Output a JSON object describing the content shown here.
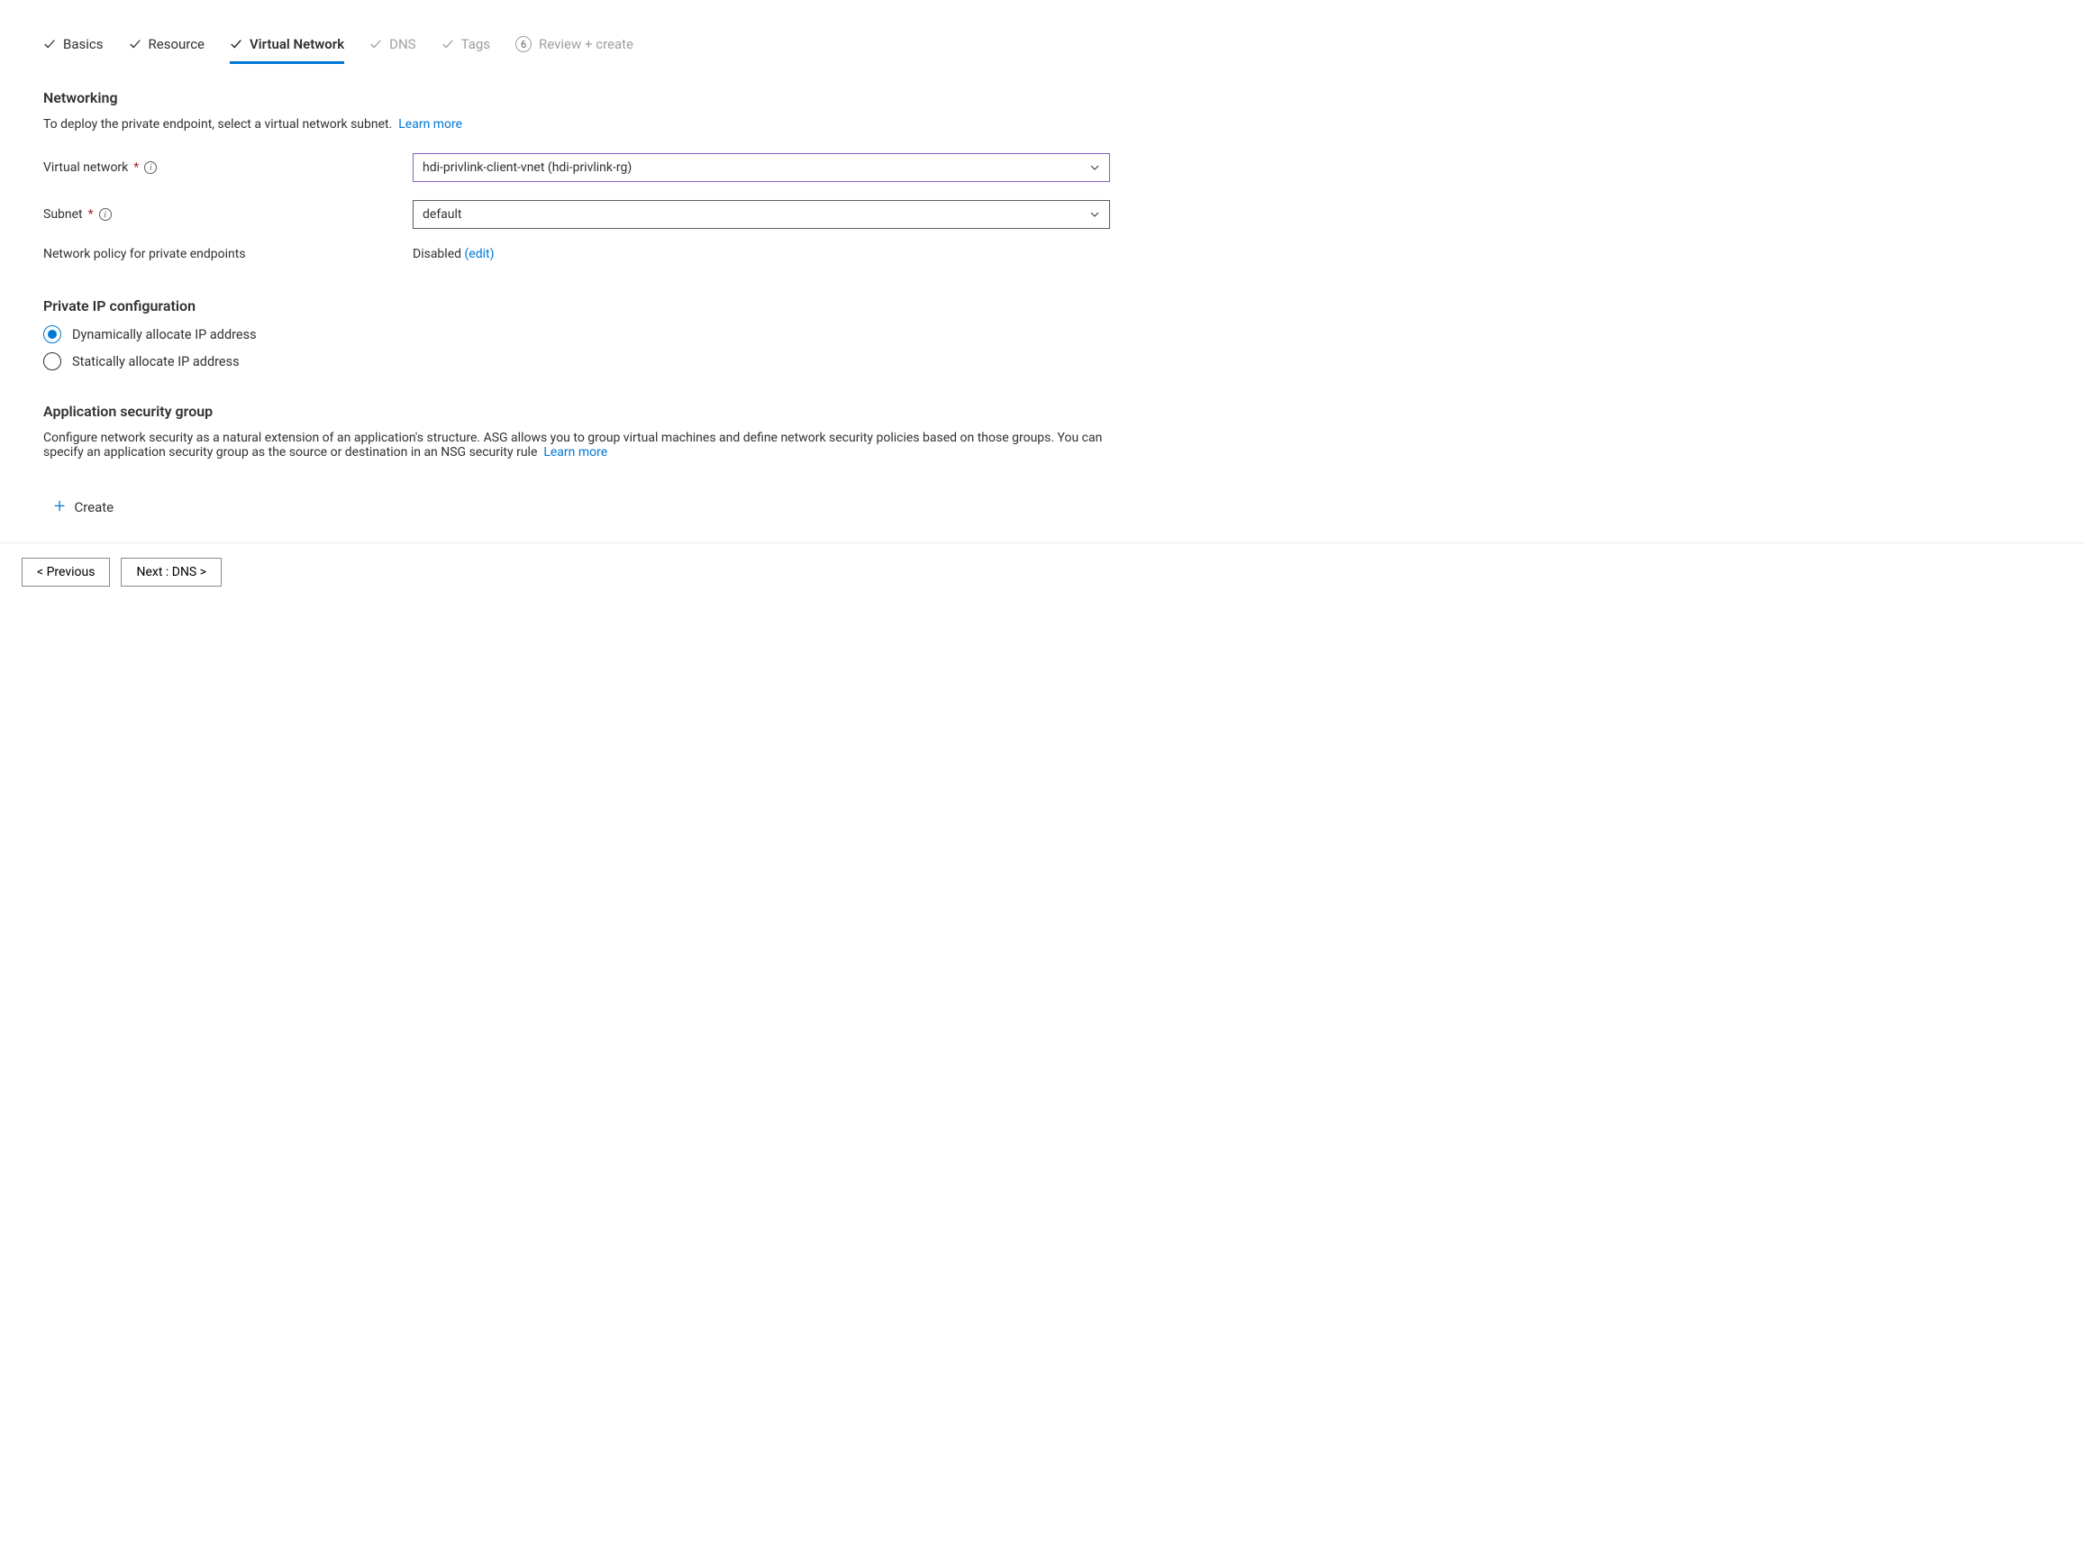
{
  "tabs": {
    "basics": "Basics",
    "resource": "Resource",
    "virtual_network": "Virtual Network",
    "dns": "DNS",
    "tags": "Tags",
    "review_step": "6",
    "review": "Review + create"
  },
  "networking": {
    "heading": "Networking",
    "desc": "To deploy the private endpoint, select a virtual network subnet.",
    "learn_more": "Learn more",
    "vnet_label": "Virtual network",
    "vnet_value": "hdi-privlink-client-vnet (hdi-privlink-rg)",
    "subnet_label": "Subnet",
    "subnet_value": "default",
    "policy_label": "Network policy for private endpoints",
    "policy_value": "Disabled",
    "policy_edit": "(edit)"
  },
  "private_ip": {
    "heading": "Private IP configuration",
    "dynamic": "Dynamically allocate IP address",
    "static": "Statically allocate IP address"
  },
  "asg": {
    "heading": "Application security group",
    "desc": "Configure network security as a natural extension of an application's structure. ASG allows you to group virtual machines and define network security policies based on those groups. You can specify an application security group as the source or destination in an NSG security rule",
    "learn_more": "Learn more",
    "create": "Create"
  },
  "footer": {
    "previous": "< Previous",
    "next": "Next : DNS >"
  }
}
